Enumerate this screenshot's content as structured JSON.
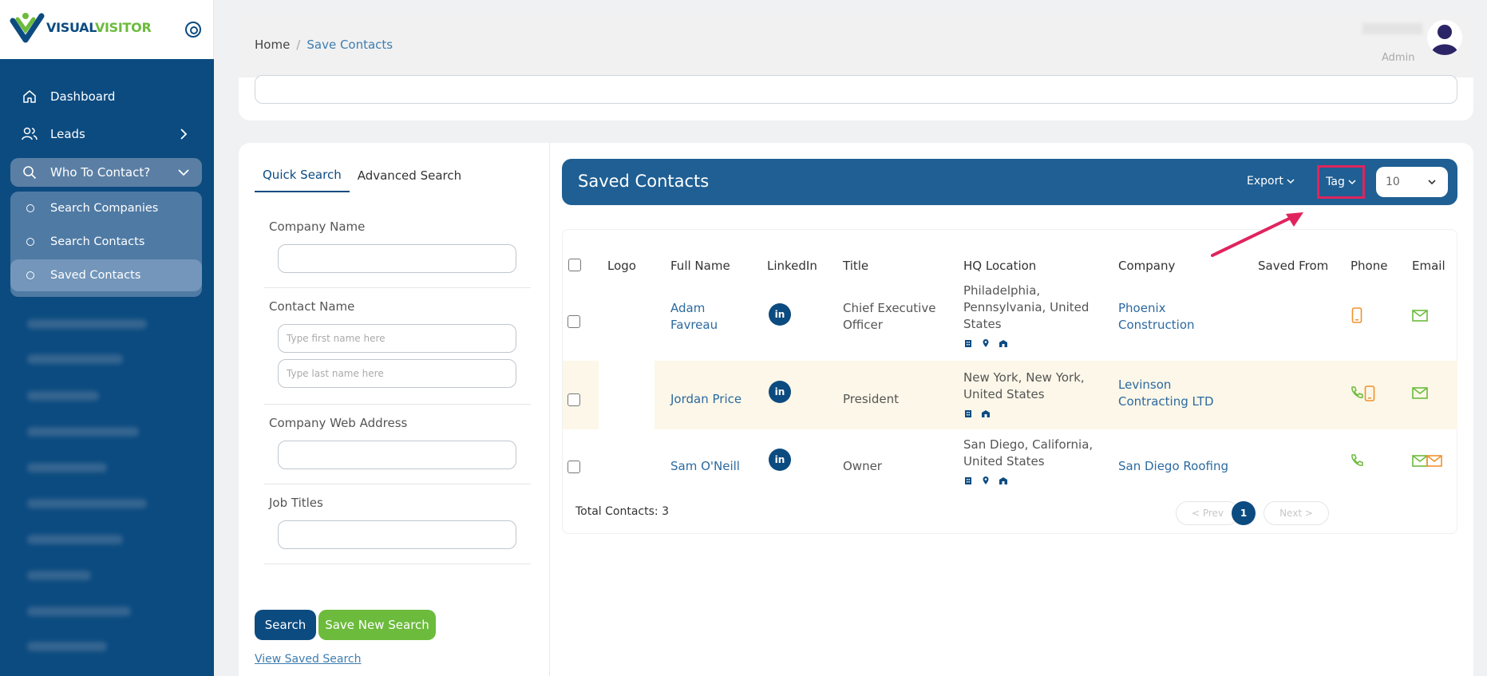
{
  "brand": {
    "name_part1": "VISUAL",
    "name_part2": "VISITOR",
    "blue": "#0c4b80",
    "green": "#6cbb3c"
  },
  "sidebar": {
    "items": [
      {
        "label": "Dashboard",
        "icon": "home-icon"
      },
      {
        "label": "Leads",
        "icon": "users-icon"
      },
      {
        "label": "Who To Contact?",
        "icon": "search-icon"
      }
    ],
    "submenu": [
      {
        "label": "Search Companies"
      },
      {
        "label": "Search Contacts"
      },
      {
        "label": "Saved Contacts"
      }
    ]
  },
  "header": {
    "breadcrumb": {
      "home": "Home",
      "separator": "/",
      "current": "Save Contacts"
    },
    "user": {
      "role": "Admin"
    }
  },
  "search_panel": {
    "tabs": [
      "Quick Search",
      "Advanced Search"
    ],
    "fields": {
      "company_name_label": "Company Name",
      "contact_name_label": "Contact Name",
      "first_name_placeholder": "Type first name here",
      "last_name_placeholder": "Type last name here",
      "company_web_label": "Company Web Address",
      "job_titles_label": "Job Titles"
    },
    "search_button": "Search",
    "save_button": "Save New Search",
    "view_saved_link": "View Saved Search"
  },
  "results": {
    "title": "Saved Contacts",
    "export_label": "Export",
    "tag_label": "Tag",
    "per_page": "10",
    "columns": [
      "Logo",
      "Full Name",
      "LinkedIn",
      "Title",
      "HQ Location",
      "Company",
      "Saved From",
      "Phone",
      "Email"
    ],
    "rows": [
      {
        "name_l1": "Adam",
        "name_l2": "Favreau",
        "title_l1": "Chief Executive",
        "title_l2": "Officer",
        "hq_l1": "Philadelphia,",
        "hq_l2": "Pennsylvania, United",
        "hq_l3": "States",
        "company_l1": "Phoenix",
        "company_l2": "Construction"
      },
      {
        "name_l1": "Jordan Price",
        "title_l1": "President",
        "hq_l1": "New York, New York,",
        "hq_l2": "United States",
        "company_l1": "Levinson",
        "company_l2": "Contracting LTD"
      },
      {
        "name_l1": "Sam O'Neill",
        "title_l1": "Owner",
        "hq_l1": "San Diego, California,",
        "hq_l2": "United States",
        "company_l1": "San Diego Roofing"
      }
    ],
    "linkedin_glyph": "in",
    "total": "Total Contacts: 3",
    "prev": "< Prev",
    "page": "1",
    "next": "Next >"
  }
}
